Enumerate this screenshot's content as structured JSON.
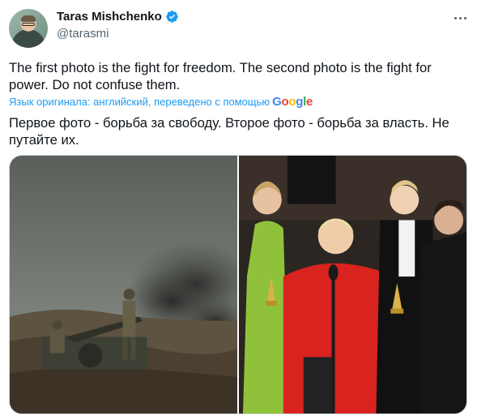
{
  "author": {
    "name": "Taras Mishchenko",
    "handle": "@tarasmi",
    "verified_icon": "verified-badge-icon",
    "avatar_icon": "avatar"
  },
  "tweet": {
    "text": "The first photo is the fight for freedom. The second photo is the fight for power. Do not confuse them.",
    "translation_note": "Язык оригинала: английский, переведено с помощью",
    "translation_provider": "Google",
    "translated_text": "Первое фото - борьба за свободу. Второе фото - борьба за власть. Не путайте их."
  },
  "media": {
    "photos": [
      {
        "icon": "war-photo"
      },
      {
        "icon": "oscar-photo"
      }
    ]
  },
  "colors": {
    "accent": "#1d9bf0",
    "text": "#0f1419",
    "secondary": "#536471"
  }
}
